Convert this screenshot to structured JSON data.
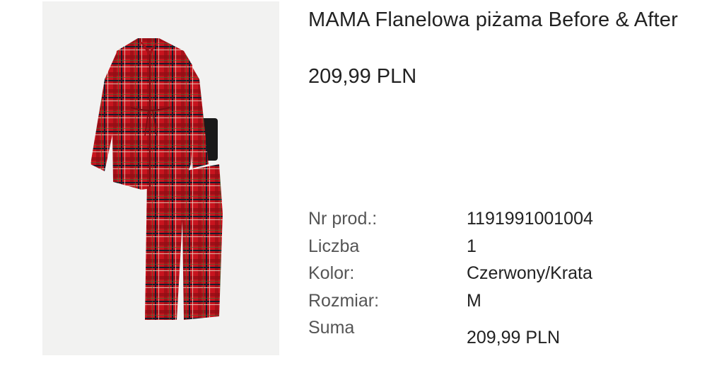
{
  "product": {
    "title": "MAMA Flanelowa piżama Before & After",
    "price": "209,99 PLN",
    "image": {
      "semantic": "red-tartan-flannel-pajama-set",
      "colors": {
        "base": "#c8141e",
        "dark_line": "#1c1c2c",
        "light_line": "#e7d9c8",
        "background": "#f2f2f1"
      }
    }
  },
  "details": [
    {
      "label": "Nr prod.:",
      "value": "1191991001004"
    },
    {
      "label": "Liczba",
      "value": "1"
    },
    {
      "label": "Kolor:",
      "value": "Czerwony/Krata"
    },
    {
      "label": "Rozmiar:",
      "value": "M"
    },
    {
      "label": "Suma",
      "value": "209,99 PLN"
    }
  ]
}
